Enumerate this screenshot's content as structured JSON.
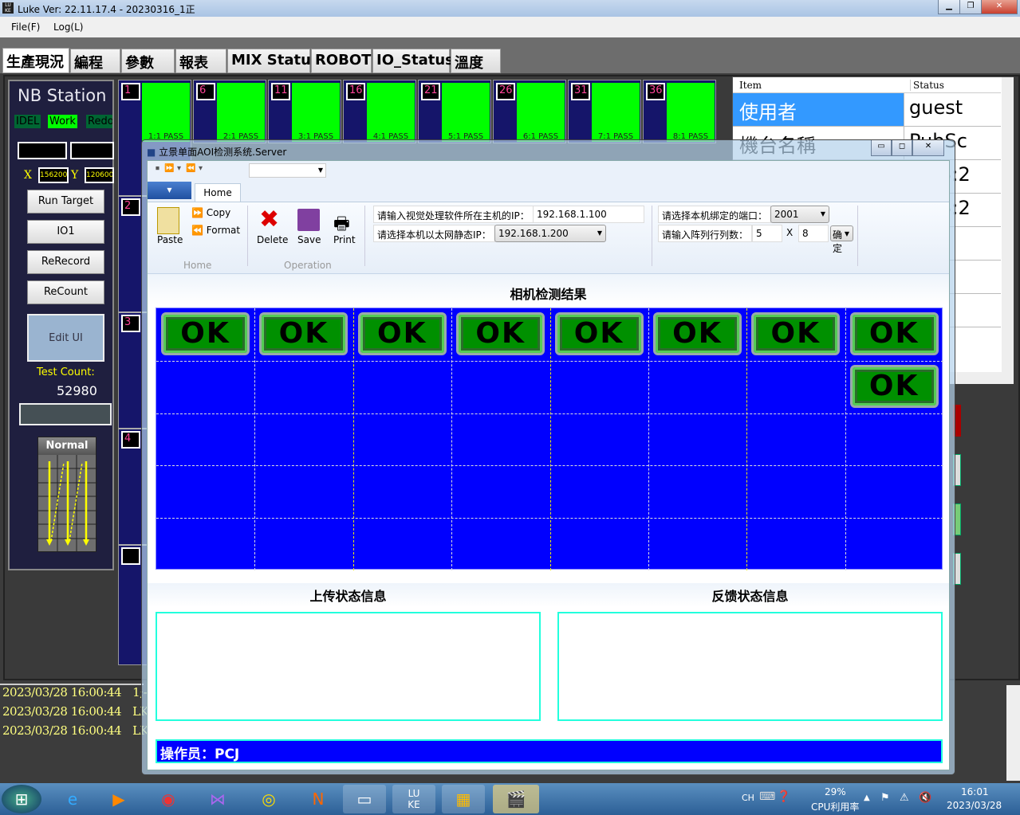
{
  "app": {
    "title": "Luke Ver: 22.11.17.4 - 20230316_1正",
    "menu": [
      "File(F)",
      "Log(L)"
    ]
  },
  "tabs": [
    "生產現況",
    "編程",
    "參數",
    "報表",
    "MIX Status",
    "ROBOT",
    "IO_Status",
    "溫度"
  ],
  "left_panel": {
    "station": "NB Station",
    "states": [
      "IDEL",
      "Work",
      "Redo"
    ],
    "x_label": "X",
    "x_value": "156200",
    "y_label": "Y",
    "y_value": "120600",
    "buttons": [
      "Run Target",
      "IO1",
      "ReRecord",
      "ReCount"
    ],
    "edit_ui": "Edit UI",
    "test_count_label": "Test Count:",
    "test_count": "52980",
    "mode": "Normal"
  },
  "stations": {
    "top_numbers": [
      "1",
      "6",
      "11",
      "16",
      "21",
      "26",
      "31",
      "36"
    ],
    "pass_labels": [
      "1:1 PASS",
      "2:1 PASS",
      "3:1 PASS",
      "4:1 PASS",
      "5:1 PASS",
      "6:1 PASS",
      "7:1 PASS",
      "8:1 PASS"
    ],
    "side_numbers": [
      "2",
      "3",
      "4",
      ""
    ]
  },
  "status_table": {
    "headers": [
      "Item",
      "Status"
    ],
    "rows": [
      [
        "使用者",
        "guest"
      ],
      [
        "機台名稱",
        "PubSc"
      ],
      [
        "",
        "3 15:2"
      ],
      [
        "",
        "3 15:2"
      ]
    ]
  },
  "log": [
    [
      "2023/03/28 16:00:44",
      "1;-"
    ],
    [
      "2023/03/28 16:00:44",
      "LK"
    ],
    [
      "2023/03/28 16:00:44",
      "LK"
    ]
  ],
  "dialog": {
    "title": "立景单面AOI检测系统.Server",
    "ribbon_tab": "Home",
    "home_group": {
      "paste": "Paste",
      "copy": "Copy",
      "format": "Format",
      "label": "Home"
    },
    "operation_group": {
      "delete": "Delete",
      "save": "Save",
      "print": "Print",
      "label": "Operation"
    },
    "vision_ip_label": "请输入视觉处理软件所在主机的IP：",
    "vision_ip": "192.168.1.100",
    "local_ip_label": "请选择本机以太网静态IP：",
    "local_ip": "192.168.1.200",
    "port_label": "请选择本机绑定的端口：",
    "port": "2001",
    "array_label": "请输入阵列行列数：",
    "rows": "5",
    "x": "X",
    "cols": "8",
    "confirm": "确定",
    "result_title": "相机检测结果",
    "ok_label": "OK",
    "ok_cells": [
      [
        0,
        0
      ],
      [
        0,
        1
      ],
      [
        0,
        2
      ],
      [
        0,
        3
      ],
      [
        0,
        4
      ],
      [
        0,
        5
      ],
      [
        0,
        6
      ],
      [
        0,
        7
      ],
      [
        1,
        7
      ]
    ],
    "grid_rows": 5,
    "grid_cols": 8,
    "upload_title": "上传状态信息",
    "feedback_title": "反馈状态信息",
    "operator": "操作员：PCJ"
  },
  "taskbar": {
    "lang": "CH",
    "cpu_percent": "29%",
    "cpu_label": "CPU利用率",
    "time": "16:01",
    "date": "2023/03/28"
  },
  "colors": {
    "pass": "#00ff00",
    "grid": "#0000ff",
    "selected": "#3399ff"
  }
}
